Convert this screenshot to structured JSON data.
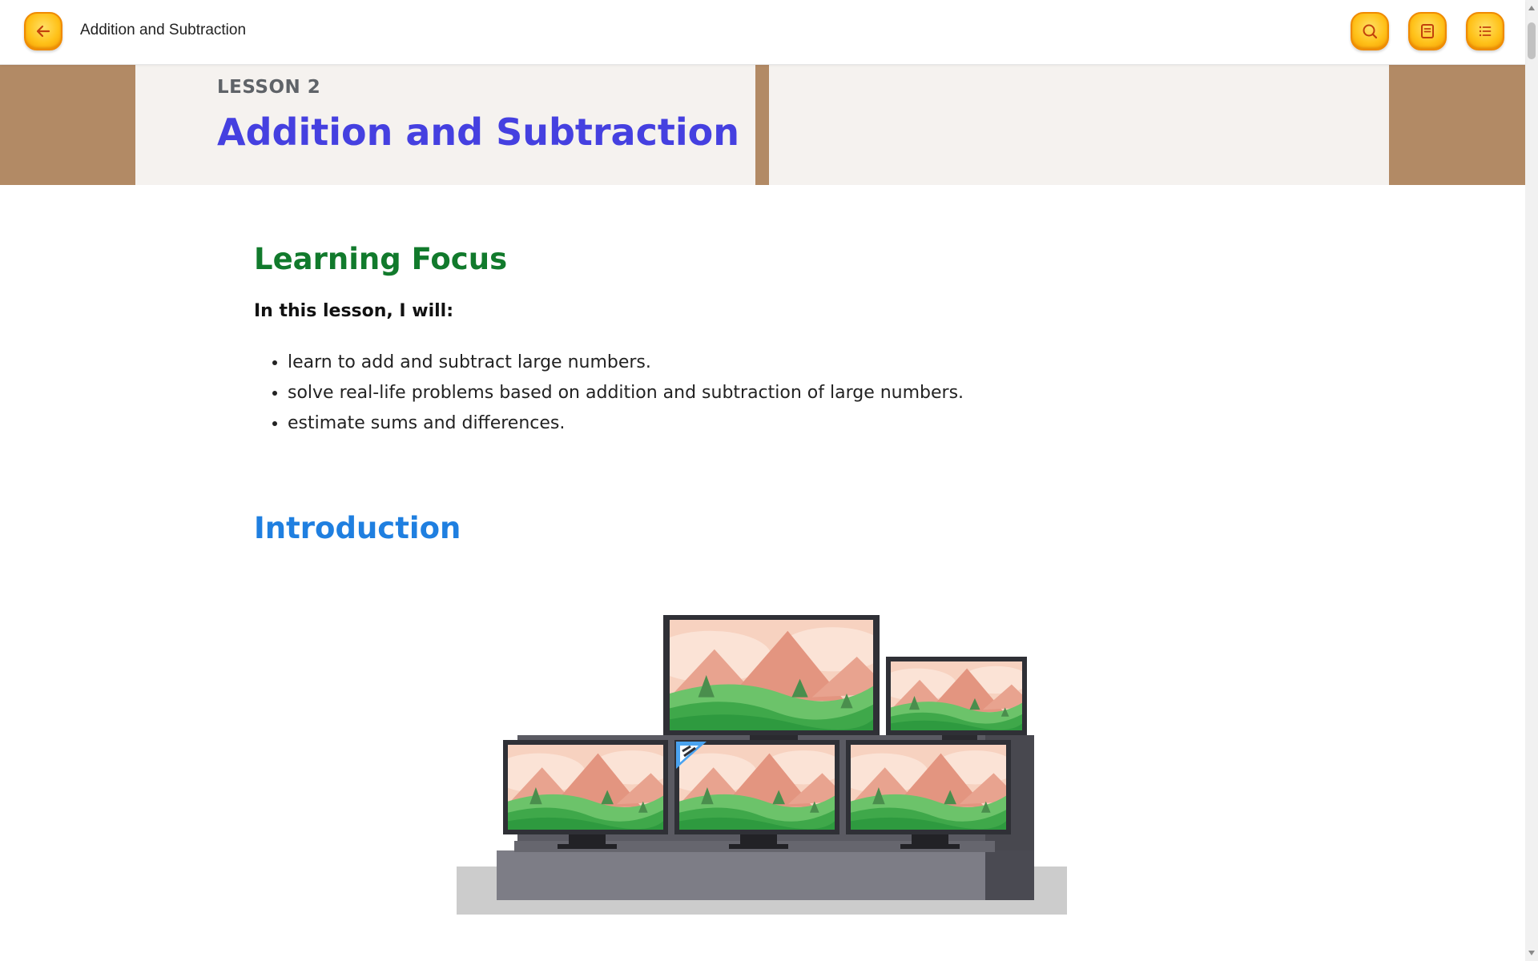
{
  "topbar": {
    "title": "Addition and Subtraction",
    "back_icon": "arrow-left-icon",
    "search_icon": "search-icon",
    "notes_icon": "note-icon",
    "menu_icon": "list-icon",
    "accent_color": "#ffc21a"
  },
  "banner": {
    "lesson_number": "LESSON 2",
    "lesson_title": "Addition and Subtraction",
    "title_color": "#4540e0"
  },
  "learning_focus": {
    "heading": "Learning Focus",
    "lead": "In this lesson, I will:",
    "items": [
      "learn to add and subtract large numbers.",
      "solve real-life problems based on addition and subtraction of large numbers.",
      "estimate sums and differences."
    ],
    "heading_color": "#117a2c"
  },
  "introduction": {
    "heading": "Introduction",
    "heading_color": "#1f7fe0",
    "illustration": "stacked-television-monitors-illustration"
  }
}
